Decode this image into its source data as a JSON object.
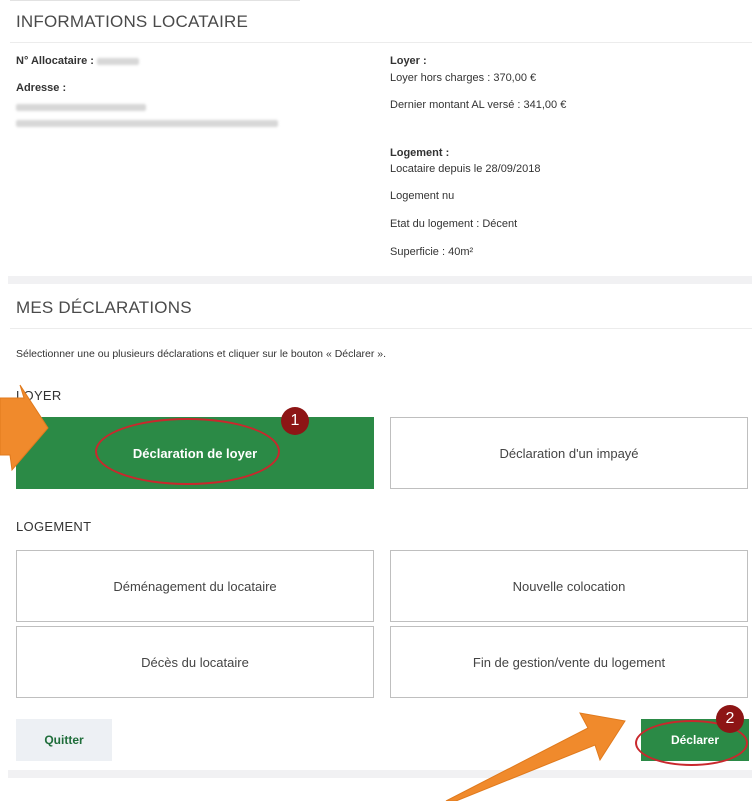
{
  "tenant_info": {
    "title": "INFORMATIONS LOCATAIRE",
    "allocataire_label": "N° Allocataire :",
    "adresse_label": "Adresse :",
    "loyer_label": "Loyer :",
    "loyer_hors_charges": "Loyer hors charges : 370,00 €",
    "dernier_montant": "Dernier montant AL versé : 341,00 €",
    "logement_label": "Logement :",
    "locataire_depuis": "Locataire depuis le 28/09/2018",
    "logement_type": "Logement nu",
    "etat": "Etat du logement : Décent",
    "superficie": "Superficie : 40m²"
  },
  "declarations": {
    "title": "MES DÉCLARATIONS",
    "instruction": "Sélectionner une ou plusieurs déclarations et cliquer sur le bouton « Déclarer ».",
    "loyer_heading": "LOYER",
    "logement_heading": "LOGEMENT",
    "tiles": {
      "declaration_loyer": "Déclaration de loyer",
      "declaration_impaye": "Déclaration d'un impayé",
      "demenagement": "Déménagement du locataire",
      "nouvelle_colocation": "Nouvelle colocation",
      "deces": "Décès du locataire",
      "fin_gestion": "Fin de gestion/vente du logement"
    },
    "selected_tile": "declaration_loyer"
  },
  "actions": {
    "quit_label": "Quitter",
    "declare_label": "Déclarer"
  },
  "annotations": {
    "step1": "1",
    "step2": "2",
    "arrow_color": "#f08a2c",
    "ring_color": "#c9282d",
    "badge_color": "#8d1515"
  },
  "colors": {
    "accent_green": "#2b8a46"
  }
}
